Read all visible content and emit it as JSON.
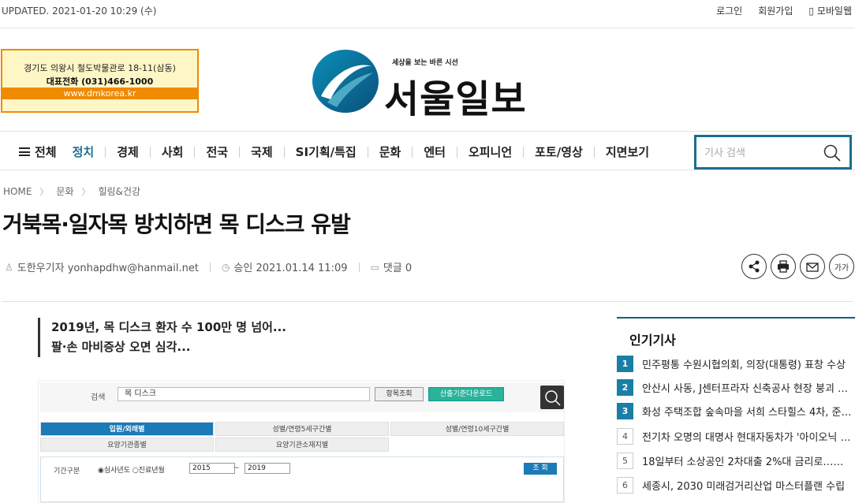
{
  "topbar": {
    "updated": "UPDATED. 2021-01-20 10:29 (수)",
    "login": "로그인",
    "signup": "회원가입",
    "mobile": "모바일웹"
  },
  "ad": {
    "address": "경기도 의왕시 철도박물관로 18-11(삼동)",
    "phone": "대표전화 (031)466-1000",
    "url": "www.dmkorea.kr"
  },
  "logo": {
    "tagline": "세상을 보는 바른 시선",
    "name": "서울일보"
  },
  "nav": {
    "all": "전체",
    "items": [
      "정치",
      "경제",
      "사회",
      "전국",
      "국제",
      "SI기획/특집",
      "문화",
      "엔터",
      "오피니언",
      "포토/영상",
      "지면보기"
    ],
    "active": "정치"
  },
  "search": {
    "placeholder": "기사 검색"
  },
  "breadcrumb": [
    "HOME",
    "문화",
    "힐링&건강"
  ],
  "article": {
    "title": "거북목·일자목 방치하면 목 디스크 유발",
    "author": "도한우기자 yonhapdhw@hanmail.net",
    "approved": "승인 2021.01.14 11:09",
    "comments": "댓글 0",
    "font_size_label": "가가",
    "subhead": [
      "2019년, 목 디스크 환자 수 100만 명 넘어...",
      "팔·손 마비증상 오면 심각..."
    ]
  },
  "embedded": {
    "search_label": "검색",
    "search_value": "목 디스크",
    "btn_lookup": "항목조회",
    "btn_download": "산출기준다운로드",
    "tabs": [
      "입원/외래별",
      "성별/연령5세구간별",
      "성별/연령10세구간별",
      "요양기관종별",
      "요양기관소재지별"
    ],
    "period_label": "기간구분",
    "radio_text": "◉심사년도 ○진료년월",
    "year_from": "2015",
    "tilde": "~",
    "year_to": "2019",
    "go": "조 회"
  },
  "popular": {
    "title": "인기기사",
    "items": [
      "민주평통 수원시협의회, 의장(대통령) 표창 수상",
      "안산시 사동, J센터프라자 신축공사 현장 붕괴 …",
      "화성 주택조합 숲속마을 서희 스타힐스 4차, 준…",
      "전기차 오명의 대명사 현대자동차가 '아이오닉 5…",
      "18일부터 소상공인 2차대출 2%대 금리로…최…",
      "세종시, 2030 미래검거리산업 마스터플랜 수립"
    ]
  },
  "colors": {
    "brand": "#1a6f8c",
    "accent": "#f08a00"
  }
}
